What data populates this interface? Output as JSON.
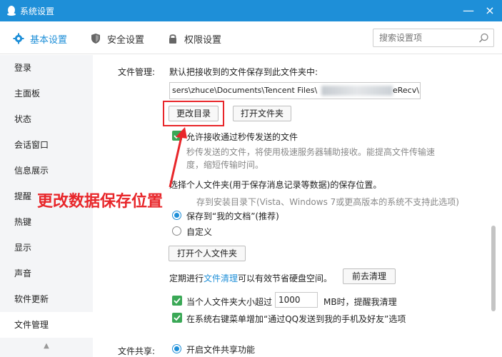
{
  "window": {
    "title": "系统设置",
    "min": "—",
    "close": "×"
  },
  "tabs": [
    {
      "label": "基本设置",
      "icon": "gear-icon",
      "active": true
    },
    {
      "label": "安全设置",
      "icon": "shield-icon",
      "active": false
    },
    {
      "label": "权限设置",
      "icon": "lock-icon",
      "active": false
    }
  ],
  "search": {
    "placeholder": "搜索设置项"
  },
  "sidebar": {
    "items": [
      {
        "label": "登录"
      },
      {
        "label": "主面板"
      },
      {
        "label": "状态"
      },
      {
        "label": "会话窗口"
      },
      {
        "label": "信息展示"
      },
      {
        "label": "提醒"
      },
      {
        "label": "热键"
      },
      {
        "label": "显示"
      },
      {
        "label": "声音"
      },
      {
        "label": "软件更新"
      },
      {
        "label": "文件管理",
        "active": true
      }
    ]
  },
  "file_management": {
    "section_label": "文件管理:",
    "default_save_text": "默认把接收到的文件保存到此文件夹中:",
    "path_value": "sers\\zhuce\\Documents\\Tencent Files\\",
    "path_tail": "eRecv\\",
    "change_dir_button": "更改目录",
    "open_folder_button": "打开文件夹",
    "allow_flash_label": "允许接收通过秒传发送的文件",
    "flash_desc_line1": "秒传发送的文件，将使用极速服务器辅助接收。能提高文件传输速",
    "flash_desc_line2": "度，缩短传输时间。",
    "personal_folder_text": "选择个人文件夹(用于保存消息记录等数据)的保存位置。",
    "install_dir_text": "存到安装目录下(Vista、Windows 7或更高版本的系统不支持此选项)",
    "save_my_docs_label": "保存到“我的文档”(推荐)",
    "custom_label": "自定义",
    "open_personal_button": "打开个人文件夹",
    "cleanup_prefix": "定期进行",
    "cleanup_link": "文件清理",
    "cleanup_suffix": "可以有效节省硬盘空间。",
    "goto_cleanup_button": "前去清理",
    "size_limit_prefix": "当个人文件夹大小超过",
    "size_limit_value": "1000",
    "size_limit_suffix": "MB时，提醒我清理",
    "context_menu_label": "在系统右键菜单增加“通过QQ发送到我的手机及好友”选项",
    "file_share_label": "文件共享:",
    "enable_share_label": "开启文件共享功能"
  },
  "annotation": {
    "text": "更改数据保存位置"
  },
  "colors": {
    "accent": "#1e8fd8",
    "annotation_red": "#e8262a",
    "check_green": "#3aa856"
  }
}
